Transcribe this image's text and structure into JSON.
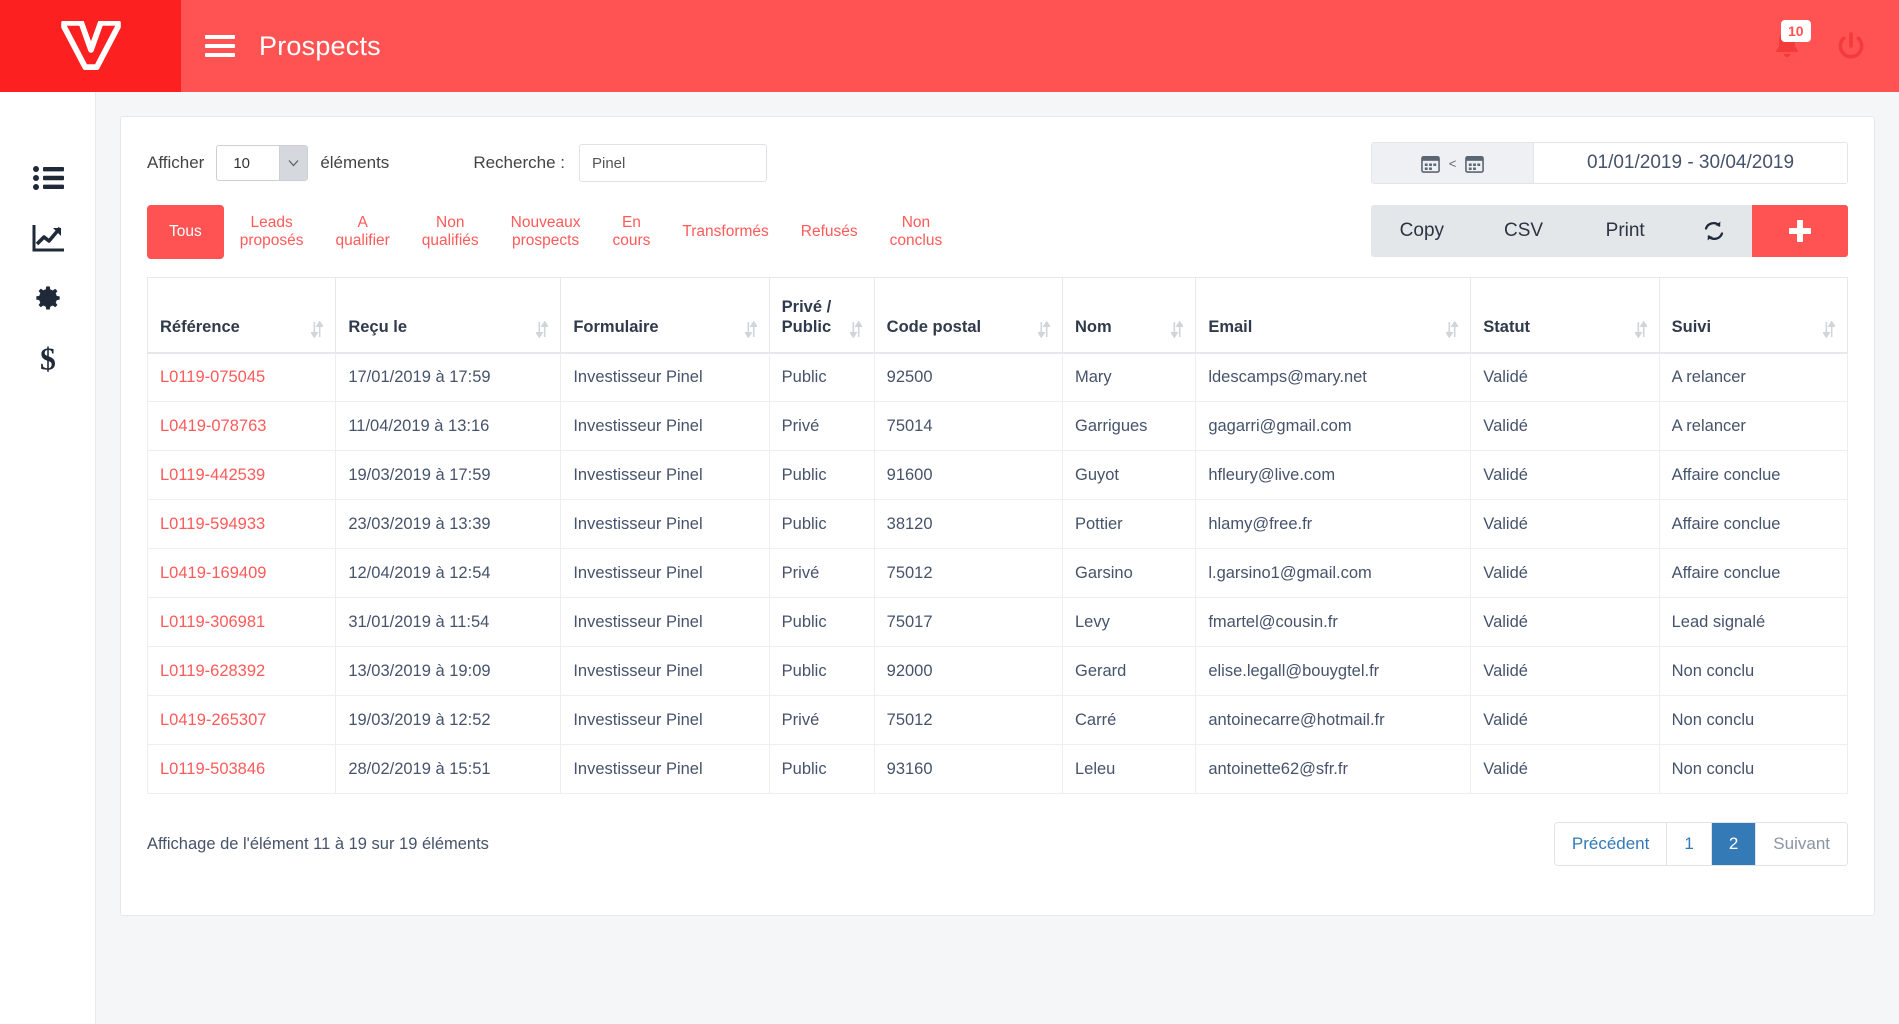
{
  "header": {
    "title": "Prospects",
    "logo_icon": "vw-logo-icon",
    "menu_icon": "hamburger-menu-icon",
    "bell_icon": "bell-icon",
    "notification_count": "10",
    "power_icon": "power-icon",
    "bar_color": "#ff5252",
    "logo_bg_color": "#fc2020"
  },
  "sidebar": {
    "items": [
      {
        "icon": "list-icon",
        "name": "sidebar-item-list"
      },
      {
        "icon": "chart-line-icon",
        "name": "sidebar-item-statistics"
      },
      {
        "icon": "gear-icon",
        "name": "sidebar-item-settings"
      },
      {
        "icon": "dollar-icon",
        "name": "sidebar-item-billing"
      }
    ]
  },
  "controls": {
    "show_label": "Afficher",
    "page_length": "10",
    "elements_label": "éléments",
    "search_label": "Recherche :",
    "search_value": "Pinel",
    "search_placeholder": "",
    "date_range": "01/01/2019 - 30/04/2019",
    "date_lt": "<",
    "calendar_icon": "calendar-icon"
  },
  "filters": {
    "tabs": [
      {
        "label": "Tous",
        "active": true
      },
      {
        "label": "Leads\nproposés",
        "active": false
      },
      {
        "label": "A\nqualifier",
        "active": false
      },
      {
        "label": "Non\nqualifiés",
        "active": false
      },
      {
        "label": "Nouveaux\nprospects",
        "active": false
      },
      {
        "label": "En\ncours",
        "active": false
      },
      {
        "label": "Transformés",
        "active": false
      },
      {
        "label": "Refusés",
        "active": false
      },
      {
        "label": "Non\nconclus",
        "active": false
      }
    ]
  },
  "actions": {
    "copy": "Copy",
    "csv": "CSV",
    "print": "Print",
    "refresh_icon": "refresh-icon",
    "add_icon": "plus-icon",
    "accent_color": "#ff5252"
  },
  "table": {
    "columns": [
      "Référence",
      "Reçu le",
      "Formulaire",
      "Privé /\nPublic",
      "Code postal",
      "Nom",
      "Email",
      "Statut",
      "Suivi"
    ],
    "rows": [
      {
        "reference": "L0119-075045",
        "recu_le": "17/01/2019 à 17:59",
        "formulaire": "Investisseur Pinel",
        "prive_public": "Public",
        "code_postal": "92500",
        "nom": "Mary",
        "email": "ldescamps@mary.net",
        "statut": "Validé",
        "suivi": "A relancer"
      },
      {
        "reference": "L0419-078763",
        "recu_le": "11/04/2019 à 13:16",
        "formulaire": "Investisseur Pinel",
        "prive_public": "Privé",
        "code_postal": "75014",
        "nom": "Garrigues",
        "email": "gagarri@gmail.com",
        "statut": "Validé",
        "suivi": "A relancer"
      },
      {
        "reference": "L0119-442539",
        "recu_le": "19/03/2019 à 17:59",
        "formulaire": "Investisseur Pinel",
        "prive_public": "Public",
        "code_postal": "91600",
        "nom": "Guyot",
        "email": "hfleury@live.com",
        "statut": "Validé",
        "suivi": "Affaire conclue"
      },
      {
        "reference": "L0119-594933",
        "recu_le": "23/03/2019 à 13:39",
        "formulaire": "Investisseur Pinel",
        "prive_public": "Public",
        "code_postal": "38120",
        "nom": "Pottier",
        "email": "hlamy@free.fr",
        "statut": "Validé",
        "suivi": "Affaire conclue"
      },
      {
        "reference": "L0419-169409",
        "recu_le": "12/04/2019 à 12:54",
        "formulaire": "Investisseur Pinel",
        "prive_public": "Privé",
        "code_postal": "75012",
        "nom": "Garsino",
        "email": "l.garsino1@gmail.com",
        "statut": "Validé",
        "suivi": "Affaire conclue"
      },
      {
        "reference": "L0119-306981",
        "recu_le": "31/01/2019 à 11:54",
        "formulaire": "Investisseur Pinel",
        "prive_public": "Public",
        "code_postal": "75017",
        "nom": "Levy",
        "email": "fmartel@cousin.fr",
        "statut": "Validé",
        "suivi": "Lead signalé"
      },
      {
        "reference": "L0119-628392",
        "recu_le": "13/03/2019 à 19:09",
        "formulaire": "Investisseur Pinel",
        "prive_public": "Public",
        "code_postal": "92000",
        "nom": "Gerard",
        "email": "elise.legall@bouygtel.fr",
        "statut": "Validé",
        "suivi": "Non conclu"
      },
      {
        "reference": "L0419-265307",
        "recu_le": "19/03/2019 à 12:52",
        "formulaire": "Investisseur Pinel",
        "prive_public": "Privé",
        "code_postal": "75012",
        "nom": "Carré",
        "email": "antoinecarre@hotmail.fr",
        "statut": "Validé",
        "suivi": "Non conclu"
      },
      {
        "reference": "L0119-503846",
        "recu_le": "28/02/2019 à 15:51",
        "formulaire": "Investisseur Pinel",
        "prive_public": "Public",
        "code_postal": "93160",
        "nom": "Leleu",
        "email": "antoinette62@sfr.fr",
        "statut": "Validé",
        "suivi": "Non conclu"
      }
    ]
  },
  "footer": {
    "info": "Affichage de l'élément 11 à 19 sur 19 éléments",
    "pagination": [
      {
        "label": "Précédent",
        "active": false,
        "muted": false
      },
      {
        "label": "1",
        "active": false,
        "muted": false
      },
      {
        "label": "2",
        "active": true,
        "muted": false
      },
      {
        "label": "Suivant",
        "active": false,
        "muted": true
      }
    ],
    "active_color": "#337ab7"
  }
}
